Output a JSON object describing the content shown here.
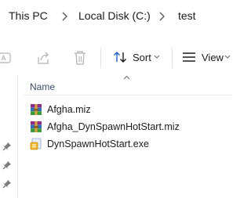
{
  "breadcrumb": {
    "items": [
      "This PC",
      "Local Disk (C:)",
      "test"
    ]
  },
  "toolbar": {
    "sort_label": "Sort",
    "view_label": "View"
  },
  "file_list": {
    "column_name": "Name",
    "files": [
      {
        "name": "Afgha.miz",
        "icon": "winrar-archive-icon"
      },
      {
        "name": "Afgha_DynSpawnHotStart.miz",
        "icon": "winrar-archive-icon"
      },
      {
        "name": "DynSpawnHotStart.exe",
        "icon": "executable-icon"
      }
    ]
  },
  "colors": {
    "accent_blue": "#1f5fbf",
    "icon_gray": "#b5b5b5"
  }
}
